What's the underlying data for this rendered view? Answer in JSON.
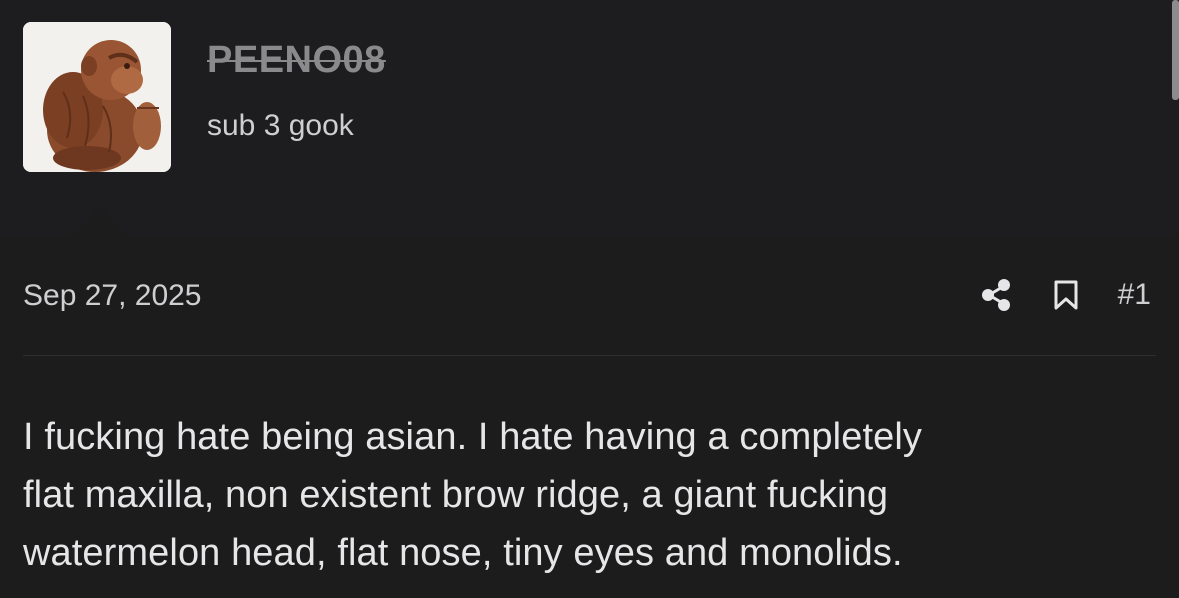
{
  "author": {
    "username": "PEENO08",
    "user_title": "sub 3 gook",
    "avatar_icon": "monkey-statue-avatar"
  },
  "post": {
    "date": "Sep 27, 2025",
    "number": "#1",
    "share_icon": "share-icon",
    "bookmark_icon": "bookmark-icon",
    "body_lines": [
      "I fucking hate being asian. I hate having a completely",
      "flat maxilla, non existent brow ridge, a giant fucking",
      "watermelon head, flat nose, tiny eyes and monolids."
    ]
  },
  "colors": {
    "background": "#1c1c1d",
    "text_primary": "#e6e6e8",
    "text_secondary": "#cfcfd2",
    "username_muted": "#8a8a8d"
  }
}
